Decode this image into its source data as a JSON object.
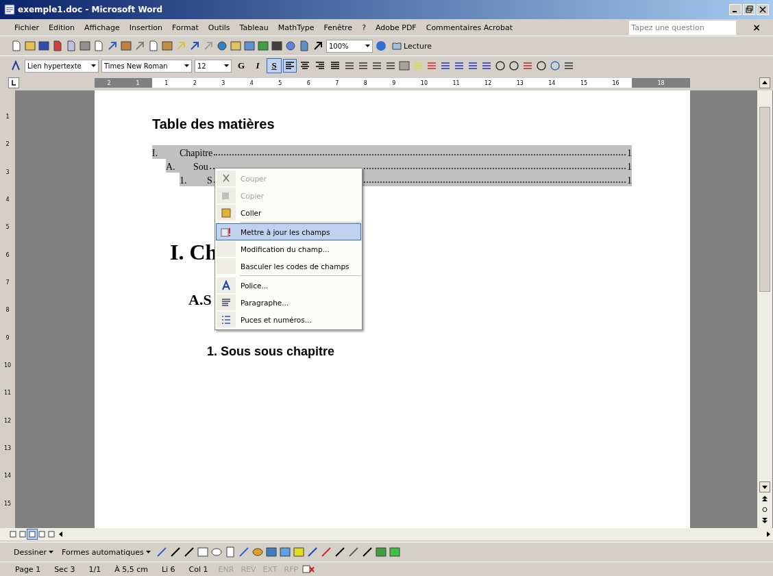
{
  "window": {
    "title": "exemple1.doc - Microsoft Word"
  },
  "menu_bar": {
    "items": [
      "Fichier",
      "Edition",
      "Affichage",
      "Insertion",
      "Format",
      "Outils",
      "Tableau",
      "MathType",
      "Fenêtre",
      "?",
      "Adobe PDF",
      "Commentaires Acrobat"
    ],
    "question_box": {
      "placeholder": "Tapez une question"
    },
    "close": "×"
  },
  "standard_toolbar": {
    "zoom": "100%",
    "reading_button": "Lecture"
  },
  "formatting_toolbar": {
    "style": "Lien hypertexte",
    "font": "Times New Roman",
    "size": "12",
    "format_buttons": [
      {
        "label": "G",
        "selected": false
      },
      {
        "label": "I",
        "selected": false
      },
      {
        "label": "S",
        "selected": true
      }
    ],
    "alignment": [
      {
        "selected": true
      },
      {
        "selected": false
      },
      {
        "selected": false
      },
      {
        "selected": false
      }
    ]
  },
  "ruler": {
    "left_numbers": [
      "2",
      "1"
    ],
    "numbers": [
      "1",
      "2",
      "3",
      "4",
      "5",
      "6",
      "7",
      "8",
      "9",
      "10",
      "11",
      "12",
      "13",
      "14",
      "15",
      "16"
    ],
    "right_numbers": [
      "18"
    ]
  },
  "vertical_ruler": {
    "numbers": [
      "1",
      "2",
      "3",
      "4",
      "5",
      "6",
      "7",
      "8",
      "9",
      "10",
      "11",
      "12",
      "13",
      "14",
      "15"
    ]
  },
  "document": {
    "toc_title": "Table des matières",
    "toc": [
      {
        "number": "I.",
        "title": "Chapitre",
        "page": "1"
      },
      {
        "number": "A.",
        "title": "Sou",
        "page": "1"
      },
      {
        "number": "1.",
        "title": "S",
        "page": "1"
      }
    ],
    "heading_1": "I. Ch",
    "heading_2": "A.S",
    "heading_3": "1. Sous sous chapitre"
  },
  "context_menu": [
    {
      "kind": "item",
      "label": "Couper",
      "disabled": true,
      "selected": false
    },
    {
      "kind": "item",
      "label": "Copier",
      "disabled": true,
      "selected": false
    },
    {
      "kind": "item",
      "label": "Coller",
      "disabled": false,
      "selected": false
    },
    {
      "kind": "separator"
    },
    {
      "kind": "item",
      "label": "Mettre à jour les champs",
      "disabled": false,
      "selected": true
    },
    {
      "kind": "item",
      "label": "Modification du champ...",
      "disabled": false,
      "selected": false
    },
    {
      "kind": "item",
      "label": "Basculer les codes de champs",
      "disabled": false,
      "selected": false
    },
    {
      "kind": "separator"
    },
    {
      "kind": "item",
      "label": "Police...",
      "disabled": false,
      "selected": false
    },
    {
      "kind": "item",
      "label": "Paragraphe...",
      "disabled": false,
      "selected": false
    },
    {
      "kind": "item",
      "label": "Puces et numéros...",
      "disabled": false,
      "selected": false
    }
  ],
  "view_buttons": [
    {
      "selected": false
    },
    {
      "selected": false
    },
    {
      "selected": true
    },
    {
      "selected": false
    },
    {
      "selected": false
    }
  ],
  "drawing_toolbar": {
    "draw_menu": "Dessiner",
    "autoshapes_menu": "Formes automatiques"
  },
  "status_bar": {
    "fields": [
      "Page 1",
      "Sec 3",
      "1/1",
      "À 5,5 cm",
      "Li 6",
      "Col 1"
    ],
    "modes": [
      {
        "label": "ENR",
        "disabled": true
      },
      {
        "label": "REV",
        "disabled": true
      },
      {
        "label": "EXT",
        "disabled": true
      },
      {
        "label": "RFP",
        "disabled": true
      }
    ]
  }
}
